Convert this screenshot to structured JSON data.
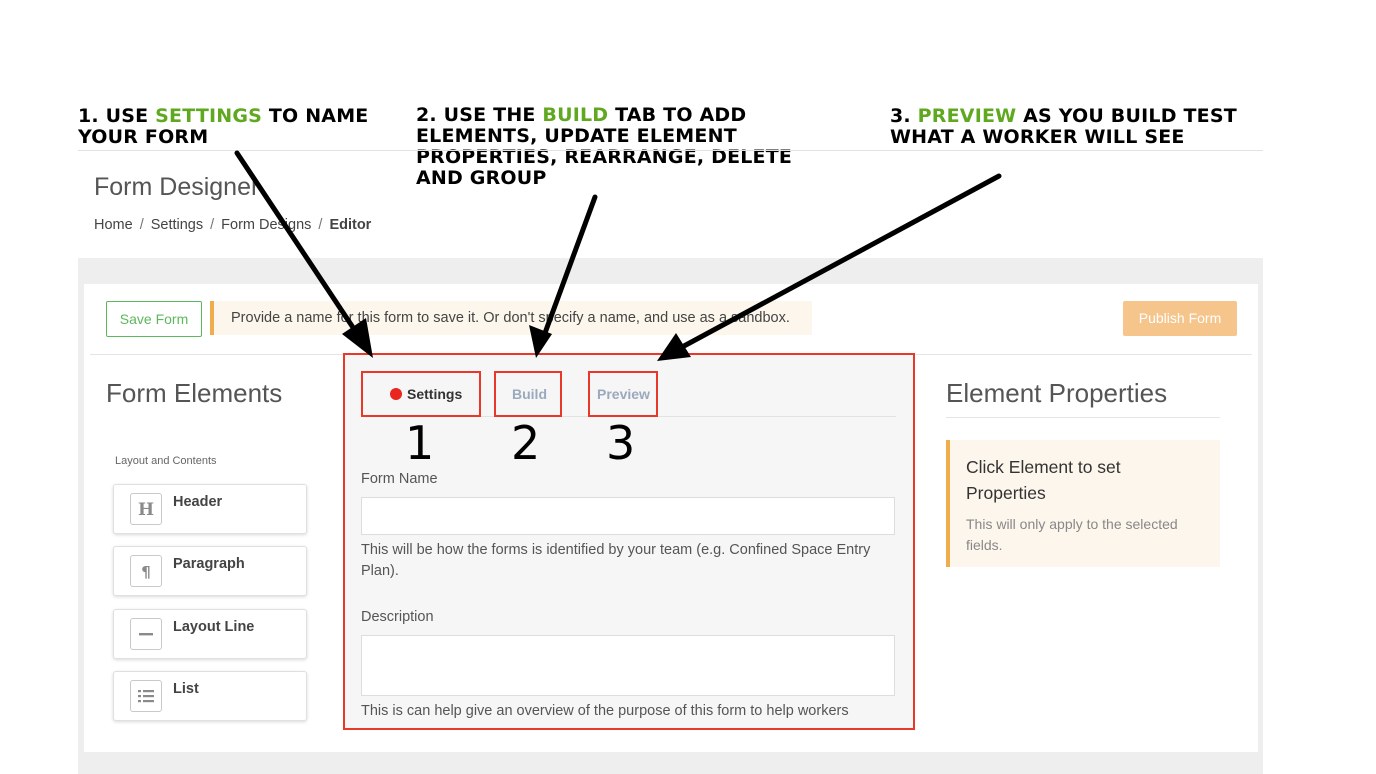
{
  "annotations": {
    "step1": {
      "prefix": "1. USE ",
      "highlight": "SETTINGS",
      "suffix": " TO NAME YOUR FORM"
    },
    "step2": {
      "prefix": "2. USE THE ",
      "highlight": "BUILD",
      "suffix": " TAB TO ADD ELEMENTS, UPDATE ELEMENT PROPERTIES, REARRANGE, DELETE AND GROUP"
    },
    "step3": {
      "prefix": "3. ",
      "highlight": "PREVIEW",
      "suffix": " AS YOU BUILD TEST WHAT A WORKER WILL SEE"
    },
    "numbers": [
      "1",
      "2",
      "3"
    ],
    "highlight_color": "#5fa81f",
    "callout_box_color": "#e8382a"
  },
  "header": {
    "title": "Form Designer",
    "breadcrumb": [
      "Home",
      "Settings",
      "Form Designs",
      "Editor"
    ],
    "separator": "/"
  },
  "toolbar": {
    "save_label": "Save Form",
    "notice": "Provide a name for this form to save it. Or don't specify a name, and use as a sandbox.",
    "publish_label": "Publish Form"
  },
  "form_elements": {
    "heading": "Form Elements",
    "group_label": "Layout and Contents",
    "items": [
      {
        "label": "Header",
        "icon": "header-icon"
      },
      {
        "label": "Paragraph",
        "icon": "paragraph-icon"
      },
      {
        "label": "Layout Line",
        "icon": "minus-icon"
      },
      {
        "label": "List",
        "icon": "list-icon"
      }
    ]
  },
  "tabs": [
    {
      "label": "Settings",
      "active": true
    },
    {
      "label": "Build",
      "active": false
    },
    {
      "label": "Preview",
      "active": false
    }
  ],
  "settings": {
    "form_name_label": "Form Name",
    "form_name_value": "",
    "form_name_help": "This will be how the forms is identified by your team (e.g. Confined Space Entry Plan).",
    "description_label": "Description",
    "description_value": "",
    "description_help": "This is can help give an overview of the purpose of this form to help workers"
  },
  "element_properties": {
    "heading": "Element Properties",
    "title": "Click Element to set Properties",
    "subtitle": "This will only apply to the selected fields."
  }
}
